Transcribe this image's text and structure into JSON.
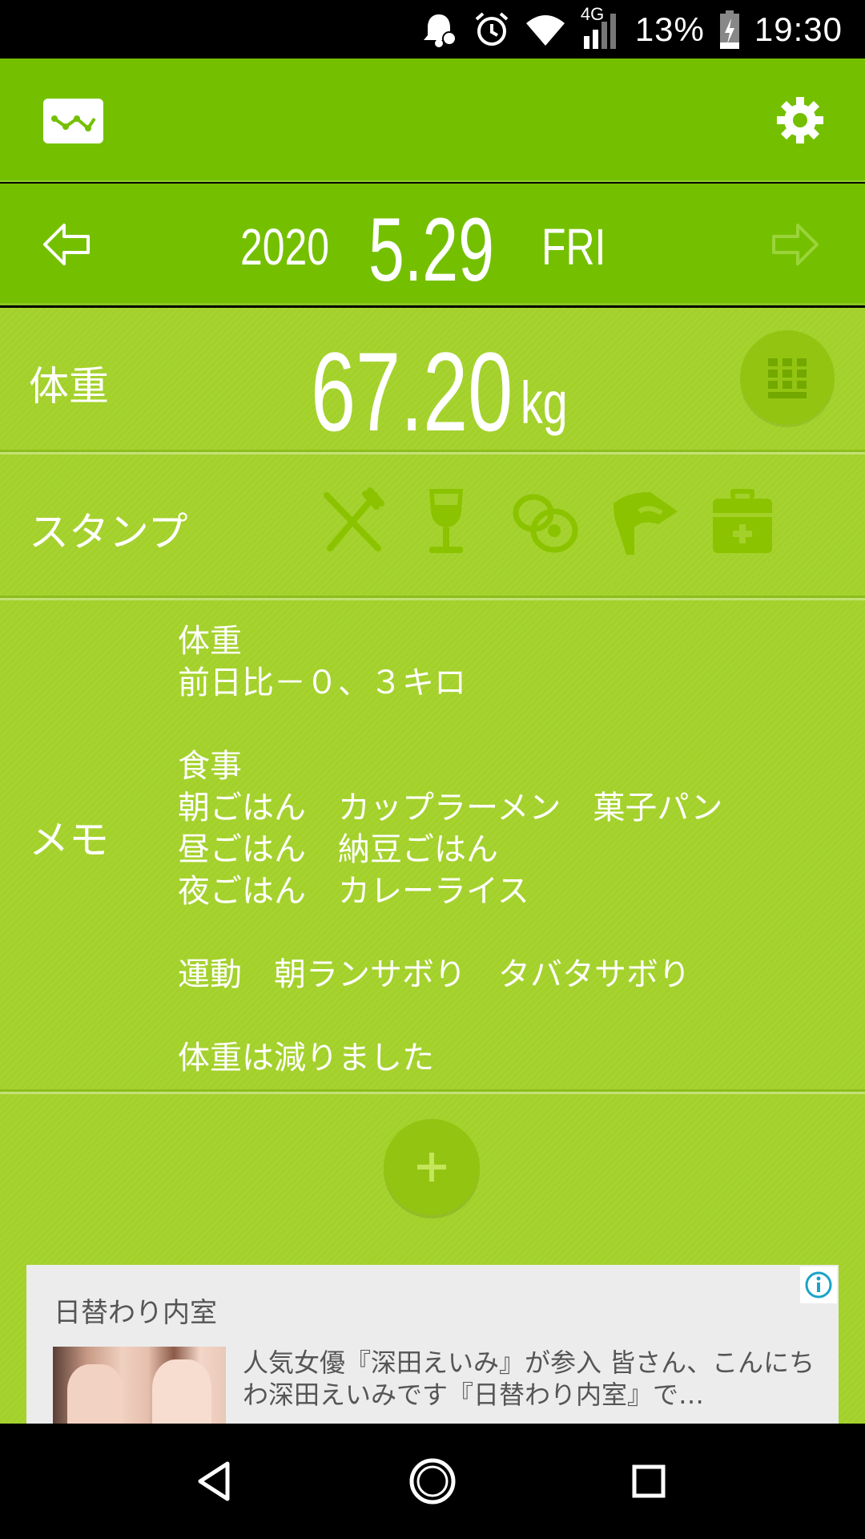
{
  "status_bar": {
    "network": "4G",
    "battery_percent": "13%",
    "time": "19:30"
  },
  "header": {
    "graph_icon": "graph-icon",
    "settings_icon": "gear-icon"
  },
  "date": {
    "year": "2020",
    "month_day": "5.29",
    "weekday": "FRI"
  },
  "weight": {
    "label": "体重",
    "value": "67.20",
    "unit": "kg"
  },
  "stamp": {
    "label": "スタンプ",
    "icons": [
      "fork-knife-icon",
      "wine-glass-icon",
      "pills-icon",
      "running-icon",
      "first-aid-kit-icon"
    ]
  },
  "memo": {
    "label": "メモ",
    "text": "体重\n前日比－０、３キロ\n\n食事\n朝ごはん　カップラーメン　菓子パン\n昼ごはん　納豆ごはん\n夜ごはん　カレーライス\n\n運動　朝ランサボり　タバタサボり\n\n体重は減りました"
  },
  "ad": {
    "title": "日替わり内室",
    "body": "人気女優『深田えいみ』が参入 皆さん、こんにちわ深田えいみです『日替わり内室』で…"
  },
  "colors": {
    "header_green": "#74c000",
    "content_green": "#a3d12a",
    "button_green": "#94c412"
  }
}
